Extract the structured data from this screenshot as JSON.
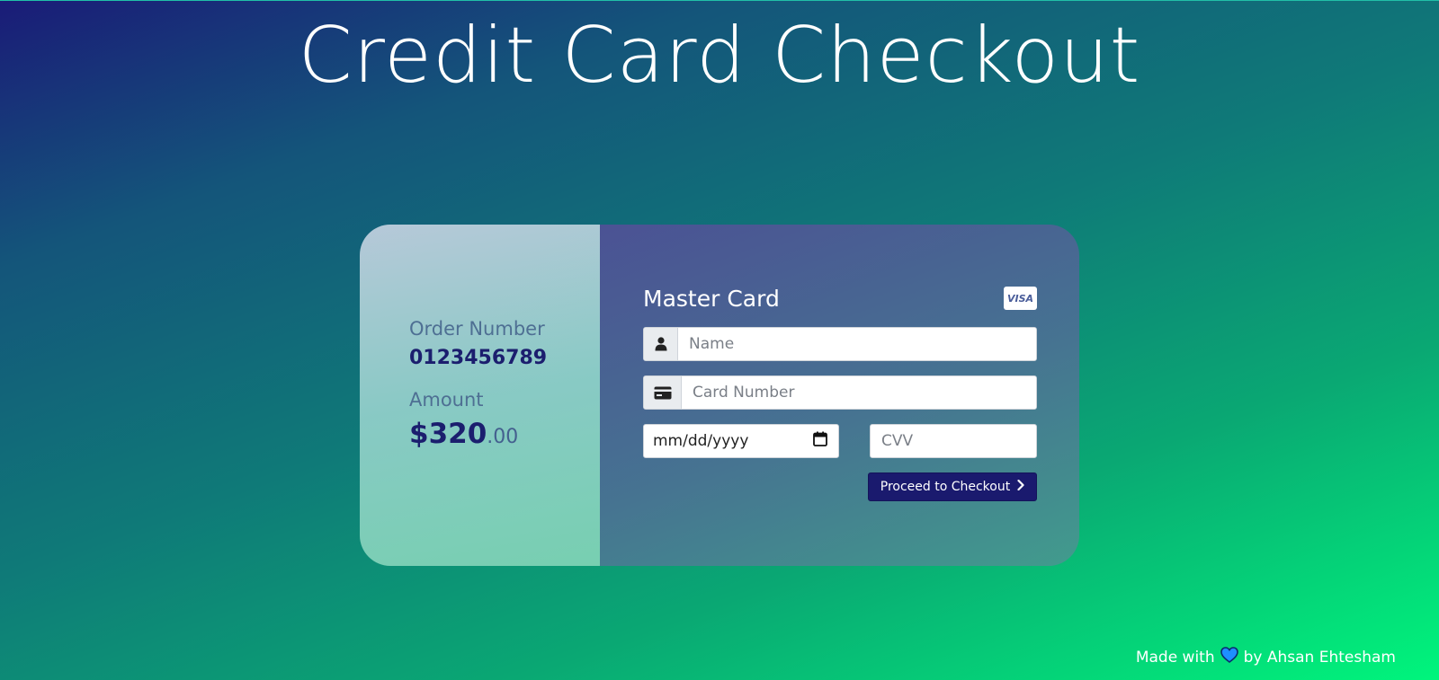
{
  "page": {
    "title": "Credit Card Checkout"
  },
  "order": {
    "number_label": "Order Number",
    "number_value": "0123456789",
    "amount_label": "Amount",
    "amount_dollars": "$320",
    "amount_cents": ".00"
  },
  "payment": {
    "card_type": "Master Card",
    "card_brand_badge": "VISA",
    "name_placeholder": "Name",
    "card_number_placeholder": "Card Number",
    "date_value": "mm/dd/yyyy",
    "cvv_placeholder": "CVV",
    "checkout_label": "Proceed to Checkout"
  },
  "footer": {
    "made_with": "Made with",
    "by": "by Ahsan Ehtesham"
  },
  "colors": {
    "button": "#1a1a6e",
    "heart": "#1e8fff",
    "order_value": "#1b1e6e"
  },
  "icons": [
    "user-icon",
    "credit-card-icon",
    "calendar-icon",
    "chevron-right-icon",
    "heart-icon"
  ]
}
